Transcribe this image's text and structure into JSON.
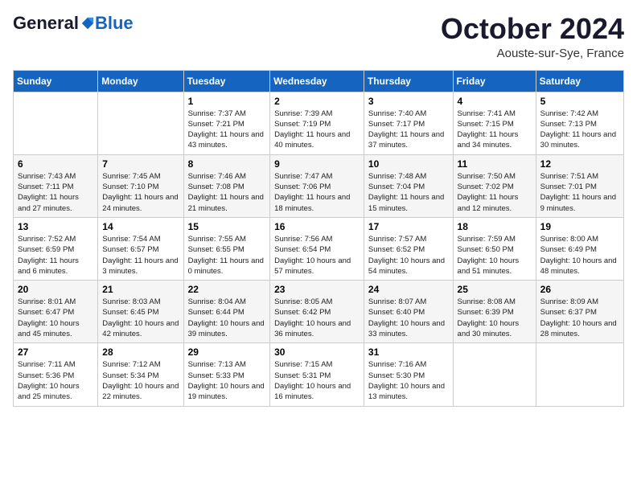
{
  "header": {
    "logo": {
      "general": "General",
      "blue": "Blue"
    },
    "title": "October 2024",
    "location": "Aouste-sur-Sye, France"
  },
  "weekdays": [
    "Sunday",
    "Monday",
    "Tuesday",
    "Wednesday",
    "Thursday",
    "Friday",
    "Saturday"
  ],
  "weeks": [
    [
      {
        "day": "",
        "sunrise": "",
        "sunset": "",
        "daylight": ""
      },
      {
        "day": "",
        "sunrise": "",
        "sunset": "",
        "daylight": ""
      },
      {
        "day": "1",
        "sunrise": "Sunrise: 7:37 AM",
        "sunset": "Sunset: 7:21 PM",
        "daylight": "Daylight: 11 hours and 43 minutes."
      },
      {
        "day": "2",
        "sunrise": "Sunrise: 7:39 AM",
        "sunset": "Sunset: 7:19 PM",
        "daylight": "Daylight: 11 hours and 40 minutes."
      },
      {
        "day": "3",
        "sunrise": "Sunrise: 7:40 AM",
        "sunset": "Sunset: 7:17 PM",
        "daylight": "Daylight: 11 hours and 37 minutes."
      },
      {
        "day": "4",
        "sunrise": "Sunrise: 7:41 AM",
        "sunset": "Sunset: 7:15 PM",
        "daylight": "Daylight: 11 hours and 34 minutes."
      },
      {
        "day": "5",
        "sunrise": "Sunrise: 7:42 AM",
        "sunset": "Sunset: 7:13 PM",
        "daylight": "Daylight: 11 hours and 30 minutes."
      }
    ],
    [
      {
        "day": "6",
        "sunrise": "Sunrise: 7:43 AM",
        "sunset": "Sunset: 7:11 PM",
        "daylight": "Daylight: 11 hours and 27 minutes."
      },
      {
        "day": "7",
        "sunrise": "Sunrise: 7:45 AM",
        "sunset": "Sunset: 7:10 PM",
        "daylight": "Daylight: 11 hours and 24 minutes."
      },
      {
        "day": "8",
        "sunrise": "Sunrise: 7:46 AM",
        "sunset": "Sunset: 7:08 PM",
        "daylight": "Daylight: 11 hours and 21 minutes."
      },
      {
        "day": "9",
        "sunrise": "Sunrise: 7:47 AM",
        "sunset": "Sunset: 7:06 PM",
        "daylight": "Daylight: 11 hours and 18 minutes."
      },
      {
        "day": "10",
        "sunrise": "Sunrise: 7:48 AM",
        "sunset": "Sunset: 7:04 PM",
        "daylight": "Daylight: 11 hours and 15 minutes."
      },
      {
        "day": "11",
        "sunrise": "Sunrise: 7:50 AM",
        "sunset": "Sunset: 7:02 PM",
        "daylight": "Daylight: 11 hours and 12 minutes."
      },
      {
        "day": "12",
        "sunrise": "Sunrise: 7:51 AM",
        "sunset": "Sunset: 7:01 PM",
        "daylight": "Daylight: 11 hours and 9 minutes."
      }
    ],
    [
      {
        "day": "13",
        "sunrise": "Sunrise: 7:52 AM",
        "sunset": "Sunset: 6:59 PM",
        "daylight": "Daylight: 11 hours and 6 minutes."
      },
      {
        "day": "14",
        "sunrise": "Sunrise: 7:54 AM",
        "sunset": "Sunset: 6:57 PM",
        "daylight": "Daylight: 11 hours and 3 minutes."
      },
      {
        "day": "15",
        "sunrise": "Sunrise: 7:55 AM",
        "sunset": "Sunset: 6:55 PM",
        "daylight": "Daylight: 11 hours and 0 minutes."
      },
      {
        "day": "16",
        "sunrise": "Sunrise: 7:56 AM",
        "sunset": "Sunset: 6:54 PM",
        "daylight": "Daylight: 10 hours and 57 minutes."
      },
      {
        "day": "17",
        "sunrise": "Sunrise: 7:57 AM",
        "sunset": "Sunset: 6:52 PM",
        "daylight": "Daylight: 10 hours and 54 minutes."
      },
      {
        "day": "18",
        "sunrise": "Sunrise: 7:59 AM",
        "sunset": "Sunset: 6:50 PM",
        "daylight": "Daylight: 10 hours and 51 minutes."
      },
      {
        "day": "19",
        "sunrise": "Sunrise: 8:00 AM",
        "sunset": "Sunset: 6:49 PM",
        "daylight": "Daylight: 10 hours and 48 minutes."
      }
    ],
    [
      {
        "day": "20",
        "sunrise": "Sunrise: 8:01 AM",
        "sunset": "Sunset: 6:47 PM",
        "daylight": "Daylight: 10 hours and 45 minutes."
      },
      {
        "day": "21",
        "sunrise": "Sunrise: 8:03 AM",
        "sunset": "Sunset: 6:45 PM",
        "daylight": "Daylight: 10 hours and 42 minutes."
      },
      {
        "day": "22",
        "sunrise": "Sunrise: 8:04 AM",
        "sunset": "Sunset: 6:44 PM",
        "daylight": "Daylight: 10 hours and 39 minutes."
      },
      {
        "day": "23",
        "sunrise": "Sunrise: 8:05 AM",
        "sunset": "Sunset: 6:42 PM",
        "daylight": "Daylight: 10 hours and 36 minutes."
      },
      {
        "day": "24",
        "sunrise": "Sunrise: 8:07 AM",
        "sunset": "Sunset: 6:40 PM",
        "daylight": "Daylight: 10 hours and 33 minutes."
      },
      {
        "day": "25",
        "sunrise": "Sunrise: 8:08 AM",
        "sunset": "Sunset: 6:39 PM",
        "daylight": "Daylight: 10 hours and 30 minutes."
      },
      {
        "day": "26",
        "sunrise": "Sunrise: 8:09 AM",
        "sunset": "Sunset: 6:37 PM",
        "daylight": "Daylight: 10 hours and 28 minutes."
      }
    ],
    [
      {
        "day": "27",
        "sunrise": "Sunrise: 7:11 AM",
        "sunset": "Sunset: 5:36 PM",
        "daylight": "Daylight: 10 hours and 25 minutes."
      },
      {
        "day": "28",
        "sunrise": "Sunrise: 7:12 AM",
        "sunset": "Sunset: 5:34 PM",
        "daylight": "Daylight: 10 hours and 22 minutes."
      },
      {
        "day": "29",
        "sunrise": "Sunrise: 7:13 AM",
        "sunset": "Sunset: 5:33 PM",
        "daylight": "Daylight: 10 hours and 19 minutes."
      },
      {
        "day": "30",
        "sunrise": "Sunrise: 7:15 AM",
        "sunset": "Sunset: 5:31 PM",
        "daylight": "Daylight: 10 hours and 16 minutes."
      },
      {
        "day": "31",
        "sunrise": "Sunrise: 7:16 AM",
        "sunset": "Sunset: 5:30 PM",
        "daylight": "Daylight: 10 hours and 13 minutes."
      },
      {
        "day": "",
        "sunrise": "",
        "sunset": "",
        "daylight": ""
      },
      {
        "day": "",
        "sunrise": "",
        "sunset": "",
        "daylight": ""
      }
    ]
  ]
}
